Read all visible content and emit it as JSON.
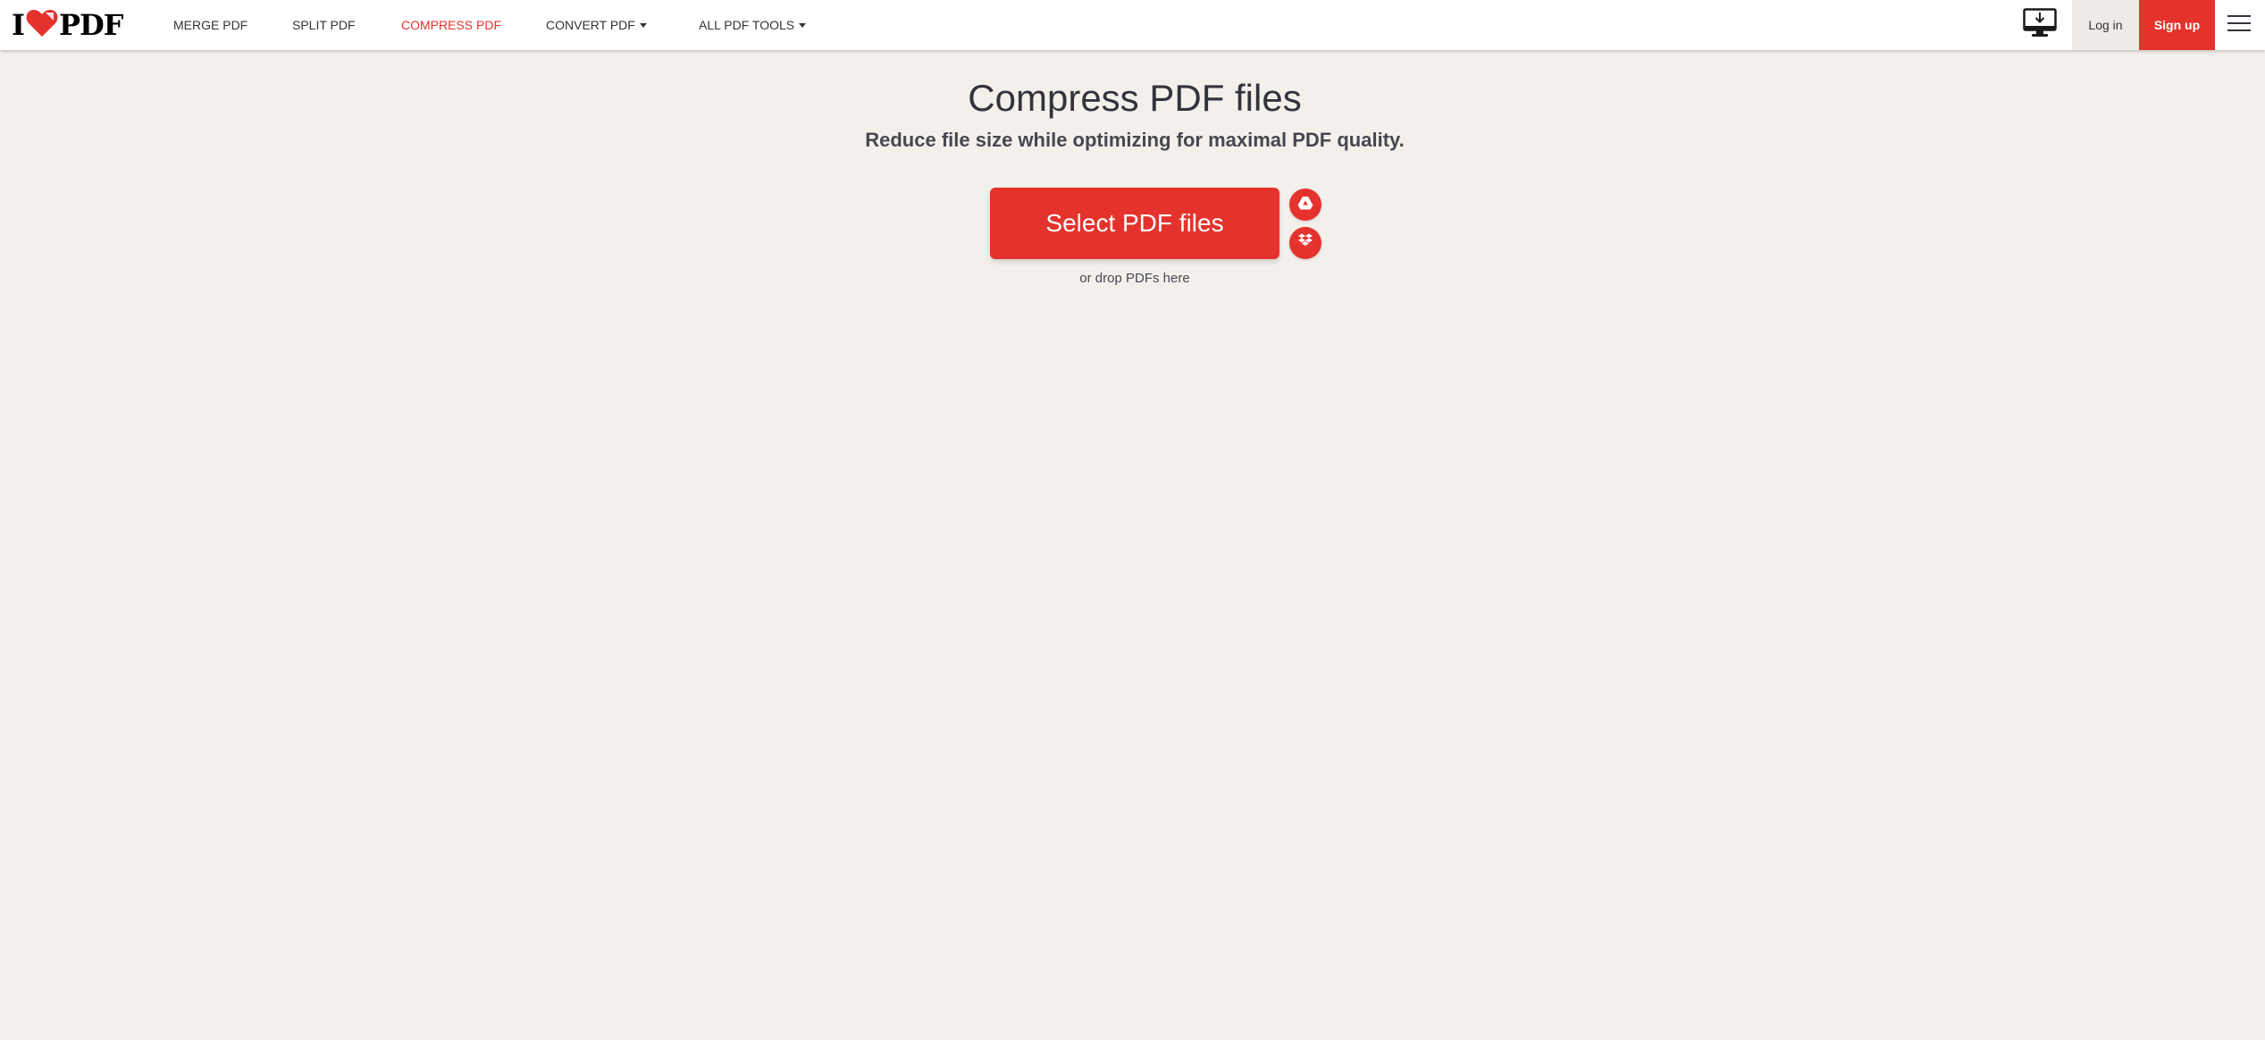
{
  "header": {
    "logo": {
      "text_before": "I",
      "text_after": "PDF",
      "heart_color": "#e5322d"
    },
    "nav": [
      {
        "label": "MERGE PDF",
        "active": false,
        "dropdown": false
      },
      {
        "label": "SPLIT PDF",
        "active": false,
        "dropdown": false
      },
      {
        "label": "COMPRESS PDF",
        "active": true,
        "dropdown": false
      },
      {
        "label": "CONVERT PDF",
        "active": false,
        "dropdown": true
      },
      {
        "label": "ALL PDF TOOLS",
        "active": false,
        "dropdown": true
      }
    ],
    "desktop_icon": "desktop-download-icon",
    "login_label": "Log in",
    "signup_label": "Sign up",
    "menu_icon": "hamburger-menu-icon"
  },
  "main": {
    "title": "Compress PDF files",
    "subtitle": "Reduce file size while optimizing for maximal PDF quality.",
    "select_button_label": "Select PDF files",
    "cloud_buttons": [
      {
        "icon": "google-drive-icon"
      },
      {
        "icon": "dropbox-icon"
      }
    ],
    "drop_hint": "or drop PDFs here"
  },
  "colors": {
    "brand_red": "#e5322d",
    "background": "#f3f0ec",
    "header_bg": "#ffffff",
    "text": "#33333b"
  }
}
